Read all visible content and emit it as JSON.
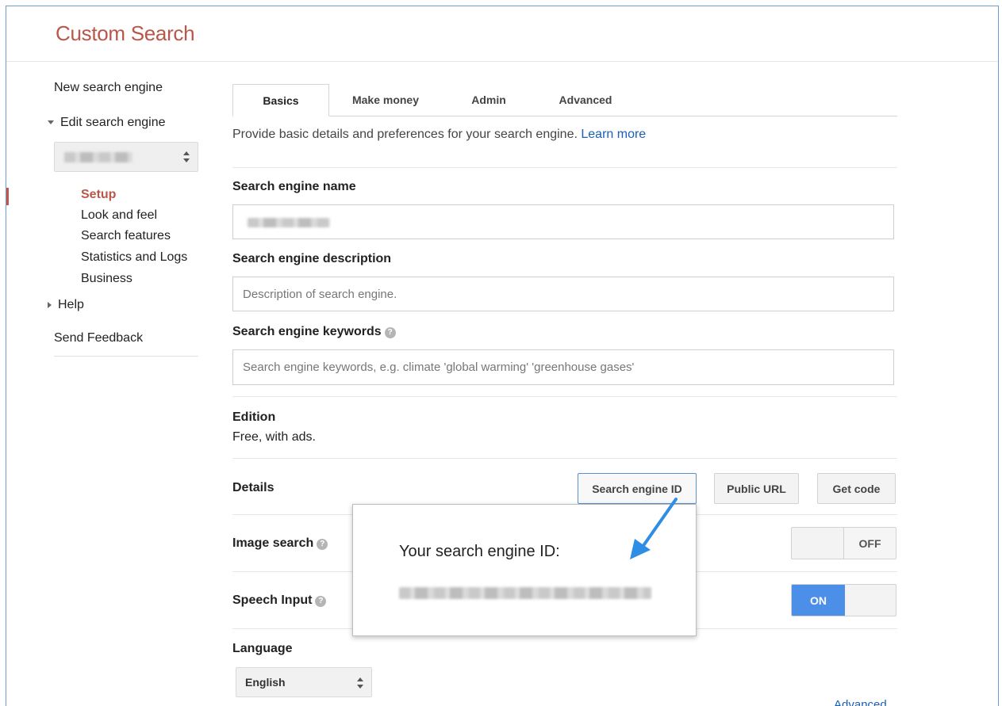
{
  "app": {
    "title": "Custom Search"
  },
  "sidebar": {
    "new_engine": "New search engine",
    "edit_engine": "Edit search engine",
    "sub_items": [
      {
        "label": "Setup",
        "active": true
      },
      {
        "label": "Look and feel"
      },
      {
        "label": "Search features"
      },
      {
        "label": "Statistics and Logs"
      },
      {
        "label": "Business"
      }
    ],
    "help": "Help",
    "send_feedback": "Send Feedback"
  },
  "tabs": [
    {
      "label": "Basics",
      "active": true
    },
    {
      "label": "Make money"
    },
    {
      "label": "Admin"
    },
    {
      "label": "Advanced"
    }
  ],
  "intro": {
    "text": "Provide basic details and preferences for your search engine.",
    "link": "Learn more"
  },
  "form": {
    "name_label": "Search engine name",
    "description_label": "Search engine description",
    "description_placeholder": "Description of search engine.",
    "keywords_label": "Search engine keywords",
    "keywords_placeholder": "Search engine keywords, e.g. climate 'global warming' 'greenhouse gases'",
    "edition_label": "Edition",
    "edition_value": "Free, with ads.",
    "details_label": "Details",
    "details_buttons": [
      "Search engine ID",
      "Public URL",
      "Get code"
    ],
    "image_search_label": "Image search",
    "image_search_state": "OFF",
    "speech_input_label": "Speech Input",
    "speech_input_state": "ON",
    "language_label": "Language",
    "language_value": "English",
    "advanced_link": "Advanced"
  },
  "popup": {
    "title": "Your search engine ID:"
  },
  "colors": {
    "brand": "#b8574a",
    "link": "#1a5fb4",
    "toggle_on": "#4b8fe8",
    "callout_arrow": "#2e8ee6"
  },
  "icons": [
    "help-icon",
    "updown-arrows-icon",
    "triangle-down-icon",
    "triangle-right-icon",
    "callout-arrow-icon"
  ]
}
